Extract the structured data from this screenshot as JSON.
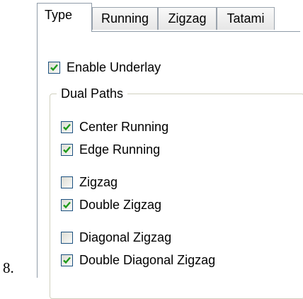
{
  "list_marker": "8.",
  "tabs": [
    {
      "label": "Type",
      "active": true
    },
    {
      "label": "Running",
      "active": false
    },
    {
      "label": "Zigzag",
      "active": false
    },
    {
      "label": "Tatami",
      "active": false
    }
  ],
  "enable_underlay": {
    "label": "Enable Underlay",
    "checked": true
  },
  "dual_paths": {
    "title": "Dual Paths",
    "options": [
      {
        "label": "Center Running",
        "checked": true
      },
      {
        "label": "Edge Running",
        "checked": true
      },
      {
        "label": "Zigzag",
        "checked": false
      },
      {
        "label": "Double Zigzag",
        "checked": true
      },
      {
        "label": "Diagonal Zigzag",
        "checked": false
      },
      {
        "label": "Double Diagonal Zigzag",
        "checked": true
      }
    ]
  },
  "colors": {
    "checkmark": "#1f9a1a",
    "checkbox_border": "#1c5180",
    "tab_border": "#8f9ba8"
  }
}
